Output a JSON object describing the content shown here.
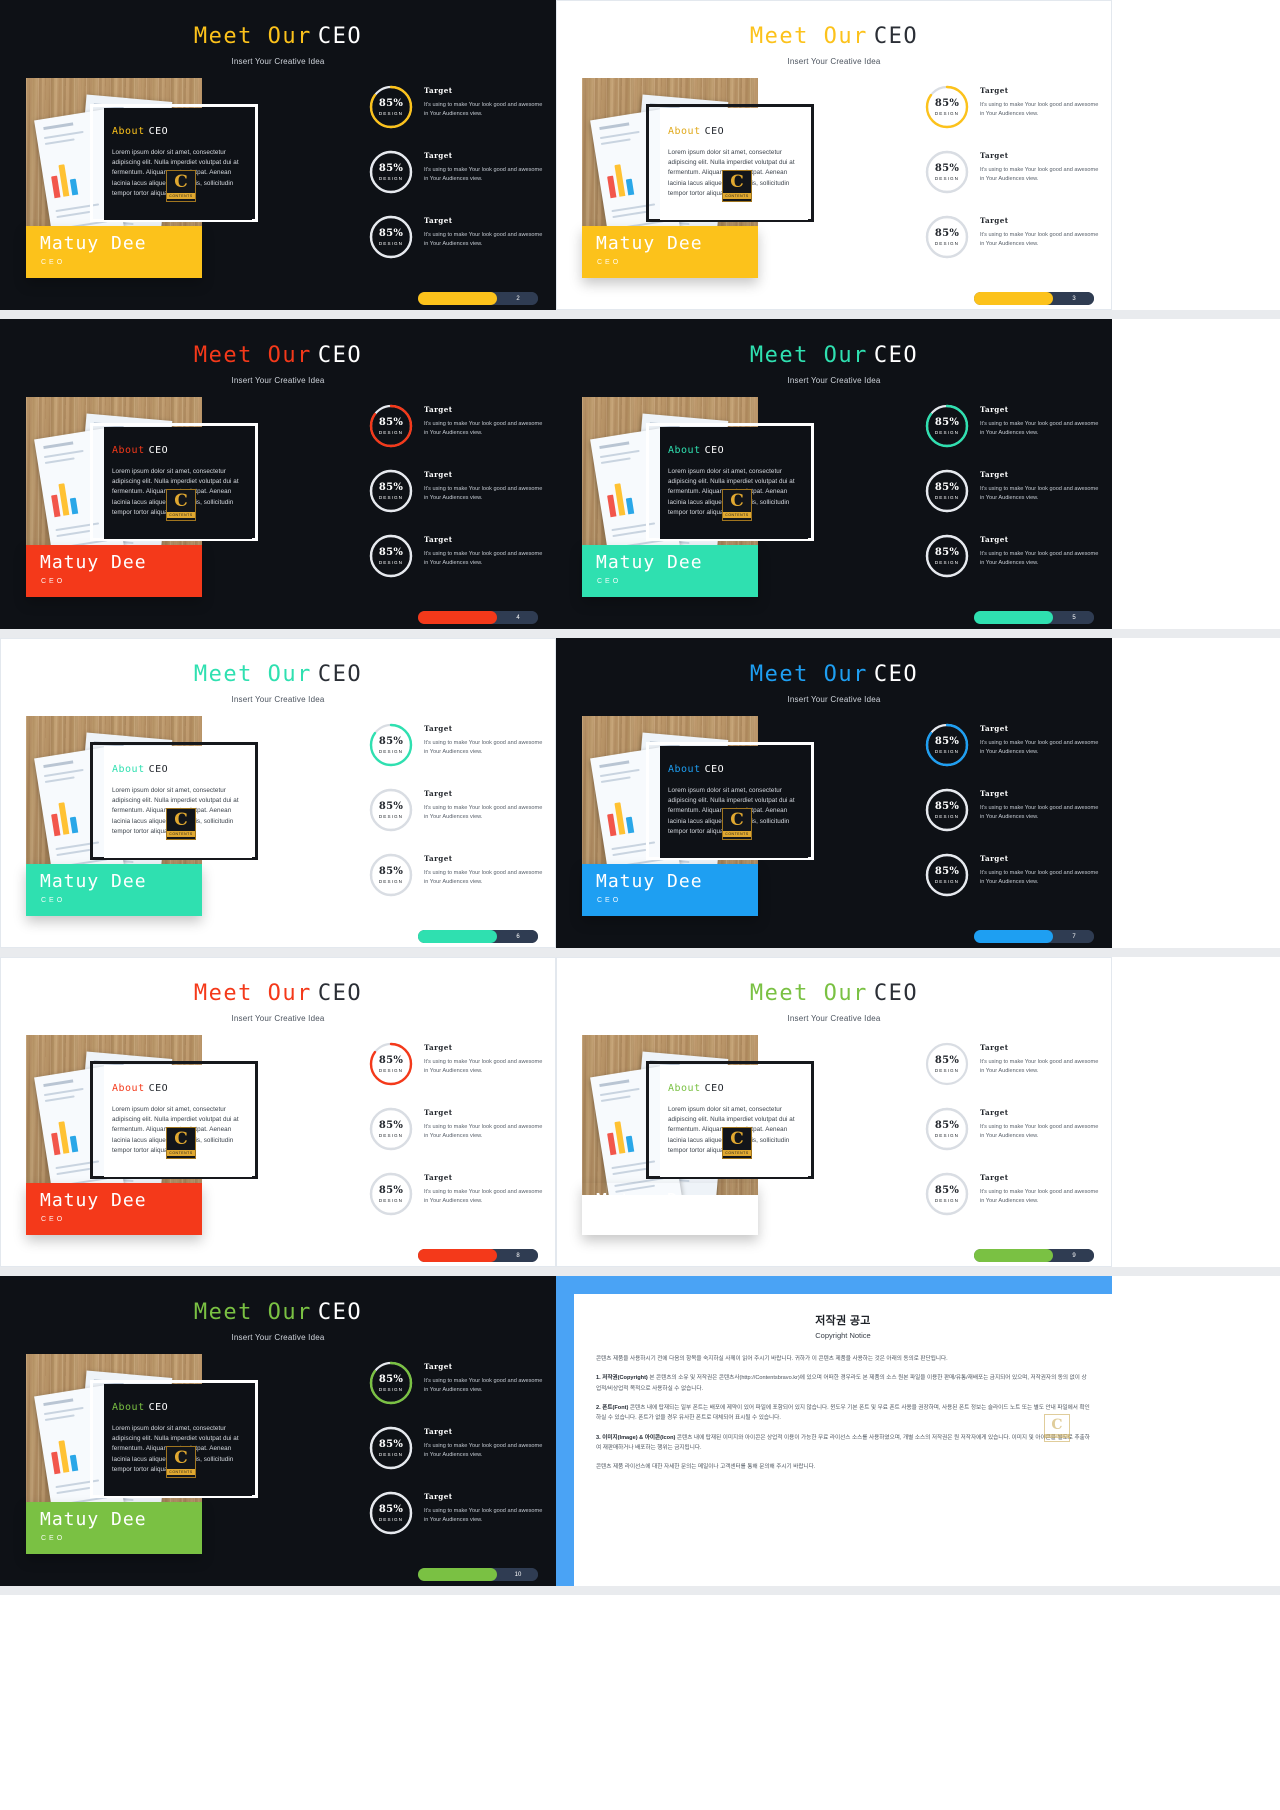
{
  "common": {
    "title_part1": "Meet Our",
    "title_part2": "CEO",
    "subtitle": "Insert Your Creative Idea",
    "about_part1": "About",
    "about_part2": "CEO",
    "about_body": "Lorem ipsum dolor sit amet, consectetur adipiscing elit. Nulla imperdiet volutpat dui at fermentum. Aliquam erat volutpat. Aenean lacinia lacus aliquet ante mollis, sollicitudin tempor tortor aliquam.",
    "person_name": "Matuy Dee",
    "person_role": "CEO",
    "badge_letter": "C",
    "badge_word": "CONTENTS",
    "stat_value": "85%",
    "stat_label": "DESIGN",
    "stat_heading": "Target",
    "stat_body": "It's using to make Your look good and awesome in Your Audiences view."
  },
  "slides": [
    {
      "index": "2",
      "theme": "dark",
      "accent": "#fcc21b",
      "title1_color": "#fcc21b",
      "about_color": "#fcc21b",
      "pager_fill": "#fcc21b"
    },
    {
      "index": "3",
      "theme": "light",
      "accent": "#fcc21b",
      "title1_color": "#fcc21b",
      "about_color": "#e0a91b",
      "pager_fill": "#fcc21b"
    },
    {
      "index": "4",
      "theme": "dark",
      "accent": "#f4391a",
      "title1_color": "#f4391a",
      "about_color": "#f4391a",
      "pager_fill": "#f4391a"
    },
    {
      "index": "5",
      "theme": "dark",
      "accent": "#2fe0b0",
      "title1_color": "#2fe0b0",
      "about_color": "#2fe0b0",
      "pager_fill": "#2fe0b0"
    },
    {
      "index": "6",
      "theme": "light",
      "accent": "#2fe0b0",
      "title1_color": "#2fe0b0",
      "about_color": "#2fe0b0",
      "pager_fill": "#2fe0b0"
    },
    {
      "index": "7",
      "theme": "dark",
      "accent": "#1e9ff2",
      "title1_color": "#1e9ff2",
      "about_color": "#1e9ff2",
      "pager_fill": "#1e9ff2"
    },
    {
      "index": "8",
      "theme": "light",
      "accent": "#f4391a",
      "title1_color": "#f4391a",
      "about_color": "#f4391a",
      "pager_fill": "#f4391a"
    },
    {
      "index": "9",
      "theme": "light",
      "accent": "#8cc council",
      "title1_color": "#7ac143",
      "about_color": "#7ac143",
      "pager_fill": "#7ac143"
    },
    {
      "index": "10",
      "theme": "dark",
      "accent": "#7ac143",
      "title1_color": "#7ac143",
      "about_color": "#7ac143",
      "pager_fill": "#7ac143"
    }
  ],
  "copyright": {
    "title": "저작권 공고",
    "subtitle": "Copyright Notice",
    "intro": "콘텐츠 제품을 사용하시기 전에 다음의 항목을 숙지하실 사께이 읽어 주시기 바랍니다. 귀하가 이 콘텐츠 제품을 사용하는 것은 아래의 동의로 판단됩니다.",
    "items": [
      {
        "num": "1. 저작권(Copyright)",
        "text": "본 콘텐츠의 소유 및 저작권은 콘텐츠사(http://Contentsbravo.kr)에 있으며 어떠한 경우라도 본 제품의 소스 원본 파일을 이용한 판매/유통/재배포는 금지되어 있으며, 저작권자의 동의 없이 상업적/비상업적 목적으로 사용하실 수 없습니다."
      },
      {
        "num": "2. 폰트(Font)",
        "text": "콘텐츠 내에 탑재되는 일부 폰트는 배포에 제약이 있어 파일에 포함되어 있지 않습니다. 윈도우 기본 폰트 및 무료 폰트 사용을 권장하며, 사용된 폰트 정보는 슬라이드 노트 또는 별도 안내 파일에서 확인하실 수 있습니다. 폰트가 없을 경우 유사한 폰트로 대체되어 표시될 수 있습니다."
      },
      {
        "num": "3. 이미지(Image) & 아이콘(Icon)",
        "text": "콘텐츠 내에 탑재된 이미지와 아이콘은 상업적 이용이 가능한 무료 라이선스 소스를 사용하였으며, 개별 소스의 저작권은 원 저작자에게 있습니다. 이미지 및 아이콘을 별도로 추출하여 재판매하거나 배포하는 행위는 금지됩니다."
      }
    ],
    "outro": "콘텐츠 제품 라이선스에 대한 자세한 문의는 메일이나 고객센터를 통해 문의해 주시기 바랍니다."
  }
}
